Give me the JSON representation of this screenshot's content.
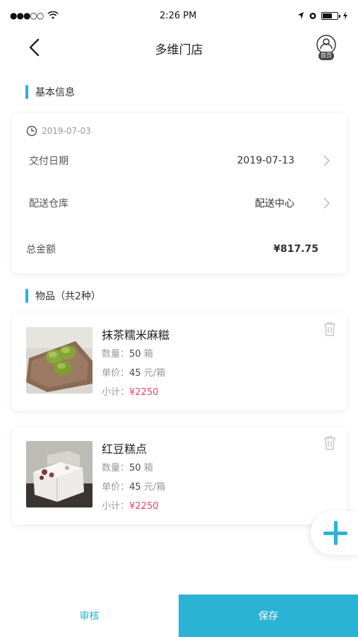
{
  "status_bar": {
    "signal": "●●●○○",
    "time": "2:26 PM",
    "right_icons": [
      "location-icon",
      "alarm-icon",
      "battery-icon",
      "charging-icon"
    ]
  },
  "header": {
    "title": "多维门店",
    "home_label": "首页"
  },
  "basic_info": {
    "section_title": "基本信息",
    "created_date": "2019-07-03",
    "delivery_date_label": "交付日期",
    "delivery_date_value": "2019-07-13",
    "warehouse_label": "配送仓库",
    "warehouse_value": "配送中心",
    "total_label": "总金额",
    "total_value": "¥817.75"
  },
  "items_section": {
    "section_title": "物品（共2种）",
    "items": [
      {
        "name": "抹茶糯米麻糍",
        "qty_label": "数量：",
        "qty_value": "50",
        "qty_unit": "箱",
        "price_label": "单价：",
        "price_value": "45",
        "price_unit": "元/箱",
        "subtotal_label": "小计：",
        "subtotal_value": "¥2250"
      },
      {
        "name": "红豆糕点",
        "qty_label": "数量：",
        "qty_value": "50",
        "qty_unit": "箱",
        "price_label": "单价：",
        "price_value": "45",
        "price_unit": "元/箱",
        "subtotal_label": "小计：",
        "subtotal_value": "¥2250"
      }
    ]
  },
  "footer": {
    "review_label": "审核",
    "save_label": "保存"
  },
  "colors": {
    "accent": "#2ab3d4",
    "price": "#f0426a"
  }
}
